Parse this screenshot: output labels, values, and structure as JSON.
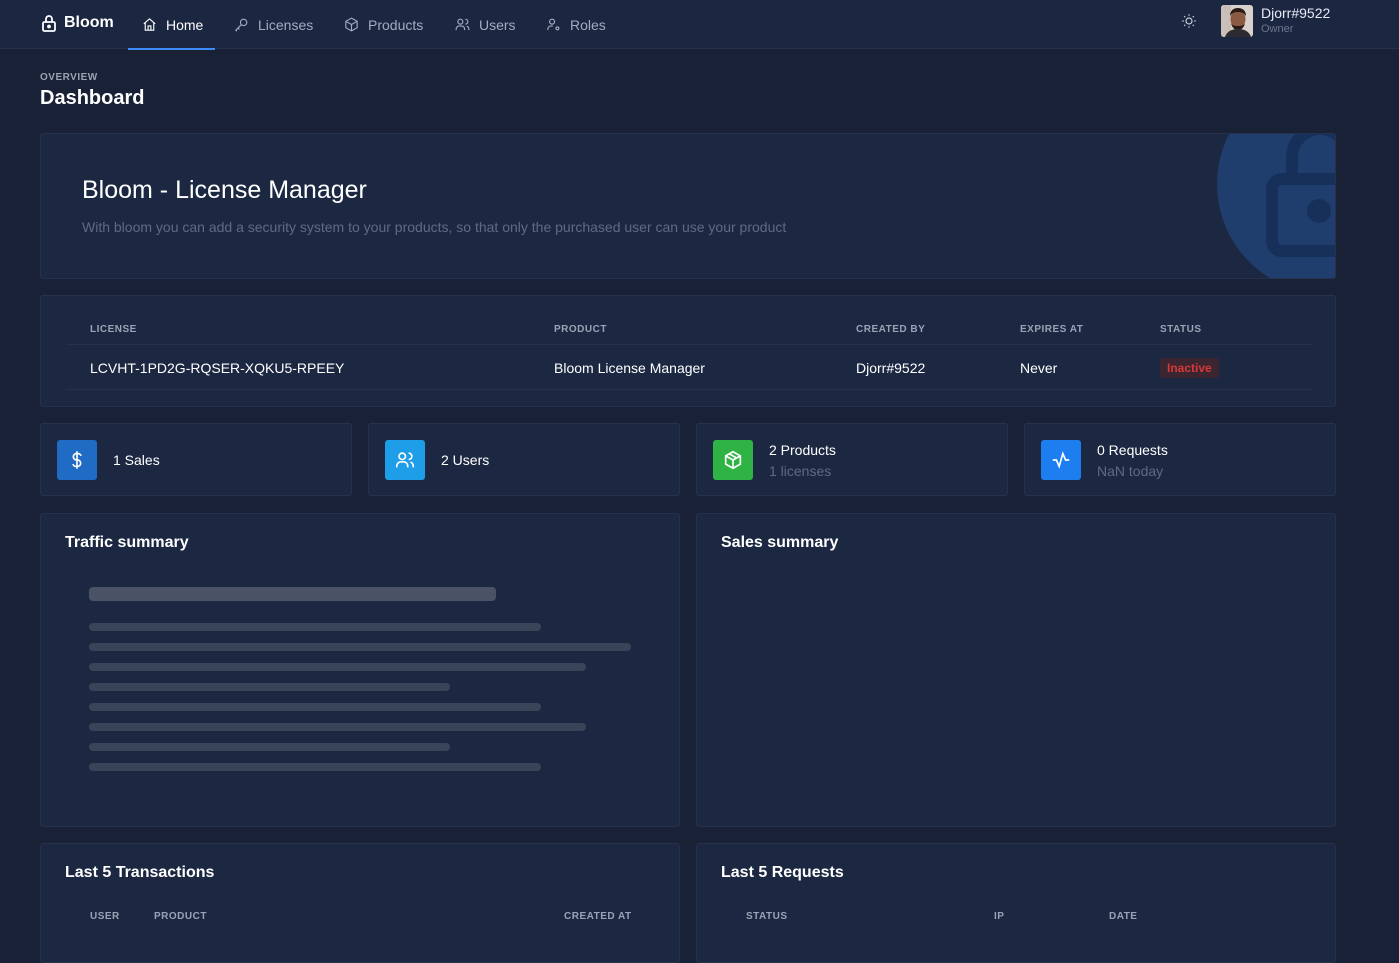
{
  "nav": {
    "brand": "Bloom",
    "items": [
      {
        "label": "Home",
        "icon": "home-icon"
      },
      {
        "label": "Licenses",
        "icon": "key-icon"
      },
      {
        "label": "Products",
        "icon": "box-icon"
      },
      {
        "label": "Users",
        "icon": "users-icon"
      },
      {
        "label": "Roles",
        "icon": "user-role-icon"
      }
    ],
    "user": {
      "name": "Djorr#9522",
      "role": "Owner"
    }
  },
  "header": {
    "pretitle": "OVERVIEW",
    "title": "Dashboard"
  },
  "hero": {
    "title": "Bloom - License Manager",
    "description": "With bloom you can add a security system to your products, so that only the purchased user can use your product"
  },
  "license_table": {
    "columns": [
      "LICENSE",
      "PRODUCT",
      "CREATED BY",
      "EXPIRES AT",
      "STATUS"
    ],
    "row": {
      "license": "LCVHT-1PD2G-RQSER-XQKU5-RPEEY",
      "product": "Bloom License Manager",
      "created_by": "Djorr#9522",
      "expires_at": "Never",
      "status": "Inactive"
    }
  },
  "stats": [
    {
      "main": "1 Sales",
      "sub": "",
      "color": "#206bc4",
      "icon": "dollar-icon"
    },
    {
      "main": "2 Users",
      "sub": "",
      "color": "#1e9de8",
      "icon": "users-icon"
    },
    {
      "main": "2 Products",
      "sub": "1 licenses",
      "color": "#2fb344",
      "icon": "box-icon"
    },
    {
      "main": "0 Requests",
      "sub": "NaN today",
      "color": "#1d7ef0",
      "icon": "activity-icon"
    }
  ],
  "panels": {
    "traffic": {
      "title": "Traffic summary"
    },
    "sales": {
      "title": "Sales summary"
    }
  },
  "transactions": {
    "title": "Last 5 Transactions",
    "columns": [
      "USER",
      "PRODUCT",
      "CREATED AT"
    ]
  },
  "requests": {
    "title": "Last 5 Requests",
    "columns": [
      "STATUS",
      "IP",
      "DATE"
    ]
  }
}
